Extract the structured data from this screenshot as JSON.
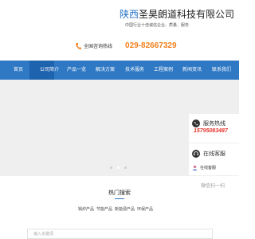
{
  "header": {
    "title_highlight": "陕西",
    "title_rest": "圣昊朗道科技有限公司",
    "subtitle": "中国行业十佳诚信企业、质量、服务",
    "phone_label": "全国咨询热线",
    "phone_number": "029-82667329"
  },
  "nav": {
    "items": [
      {
        "label": "首页"
      },
      {
        "label": "公司简介"
      },
      {
        "label": "产品一览"
      },
      {
        "label": "解决方案"
      },
      {
        "label": "技术服务"
      },
      {
        "label": "工程案例"
      },
      {
        "label": "新闻资讯"
      },
      {
        "label": "联系我们"
      }
    ],
    "active_index": 1
  },
  "banner": {
    "slide_count": 3,
    "active_slide": 1
  },
  "hot_search": {
    "title": "热门搜索",
    "links": [
      "锅炉产品",
      "节能产品",
      "新能源产品",
      "环保产品"
    ],
    "search_placeholder": "输入关键词"
  },
  "side_widget": {
    "hotline_label": "服务热线",
    "hotline_number": "15795083487",
    "online_label": "在线客服",
    "agent_label": "在线客服",
    "qr_label": "微信扫一扫"
  },
  "colors": {
    "brand_blue": "#2f78c4",
    "nav_active": "#1e63ad",
    "phone_orange": "#f4801f",
    "hotline_red": "#e8332c"
  }
}
